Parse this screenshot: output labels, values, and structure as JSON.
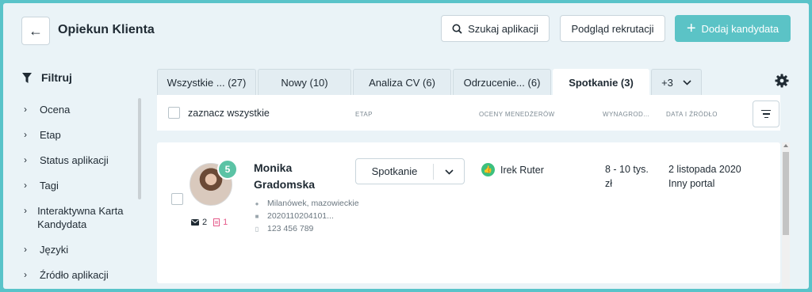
{
  "header": {
    "title": "Opiekun Klienta",
    "search_label": "Szukaj aplikacji",
    "preview_label": "Podgląd rekrutacji",
    "add_label": "Dodaj kandydata"
  },
  "sidebar": {
    "title": "Filtruj",
    "items": [
      {
        "label": "Ocena"
      },
      {
        "label": "Etap"
      },
      {
        "label": "Status aplikacji"
      },
      {
        "label": "Tagi"
      },
      {
        "label": "Interaktywna Karta Kandydata"
      },
      {
        "label": "Języki"
      },
      {
        "label": "Źródło aplikacji"
      }
    ]
  },
  "tabs": [
    {
      "label": "Wszystkie ... (27)"
    },
    {
      "label": "Nowy (10)"
    },
    {
      "label": "Analiza CV (6)"
    },
    {
      "label": "Odrzucenie... (6)"
    },
    {
      "label": "Spotkanie (3)"
    },
    {
      "label": "+3"
    }
  ],
  "table": {
    "select_all": "zaznacz wszystkie",
    "columns": [
      "ETAP",
      "OCENY MENEDŻERÓW",
      "WYNAGROD...",
      "DATA I ŹRÓDŁO"
    ]
  },
  "candidate": {
    "score": "5",
    "first_name": "Monika",
    "last_name": "Gradomska",
    "location": "Milanówek, mazowieckie",
    "id": "2020110204101...",
    "phone": "123 456 789",
    "messages": "2",
    "documents": "1",
    "stage": "Spotkanie",
    "manager": "Irek Ruter",
    "salary": "8 - 10 tys. zł",
    "date": "2 listopada 2020",
    "source": "Inny portal"
  }
}
